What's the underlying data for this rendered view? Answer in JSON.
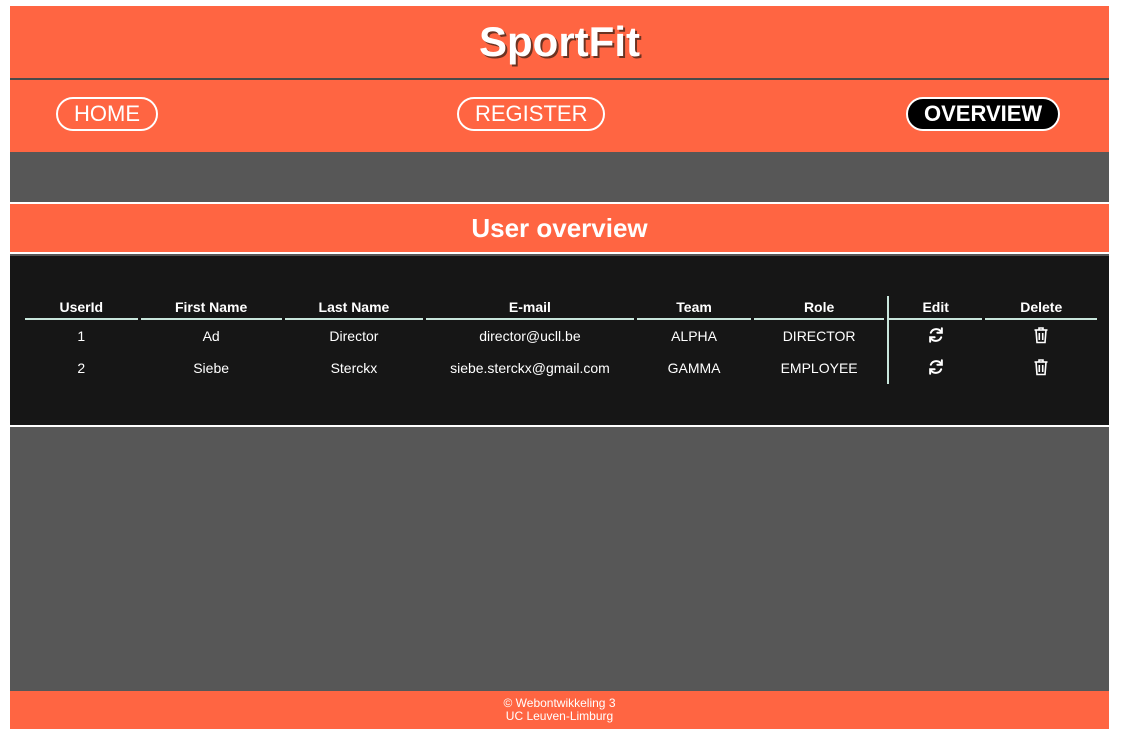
{
  "site": {
    "title": "SportFit"
  },
  "nav": {
    "items": [
      {
        "label": "HOME"
      },
      {
        "label": "REGISTER"
      },
      {
        "label": "OVERVIEW"
      }
    ],
    "active": "OVERVIEW"
  },
  "page": {
    "heading": "User overview"
  },
  "table": {
    "headers": [
      "UserId",
      "First Name",
      "Last Name",
      "E-mail",
      "Team",
      "Role",
      "Edit",
      "Delete"
    ],
    "rows": [
      {
        "id": "1",
        "first_name": "Ad",
        "last_name": "Director",
        "email": "director@ucll.be",
        "team": "ALPHA",
        "role": "DIRECTOR",
        "edit_icon": "refresh-icon",
        "delete_icon": "trash-icon"
      },
      {
        "id": "2",
        "first_name": "Siebe",
        "last_name": "Sterckx",
        "email": "siebe.sterckx@gmail.com",
        "team": "GAMMA",
        "role": "EMPLOYEE",
        "edit_icon": "refresh-icon",
        "delete_icon": "trash-icon"
      }
    ]
  },
  "footer": {
    "line1": "© Webontwikkeling 3",
    "line2": "UC Leuven-Limburg"
  },
  "colors": {
    "accent": "#ff6542",
    "panel": "#575757",
    "table_bg": "#161616",
    "header_rule": "#c8e6dc"
  }
}
